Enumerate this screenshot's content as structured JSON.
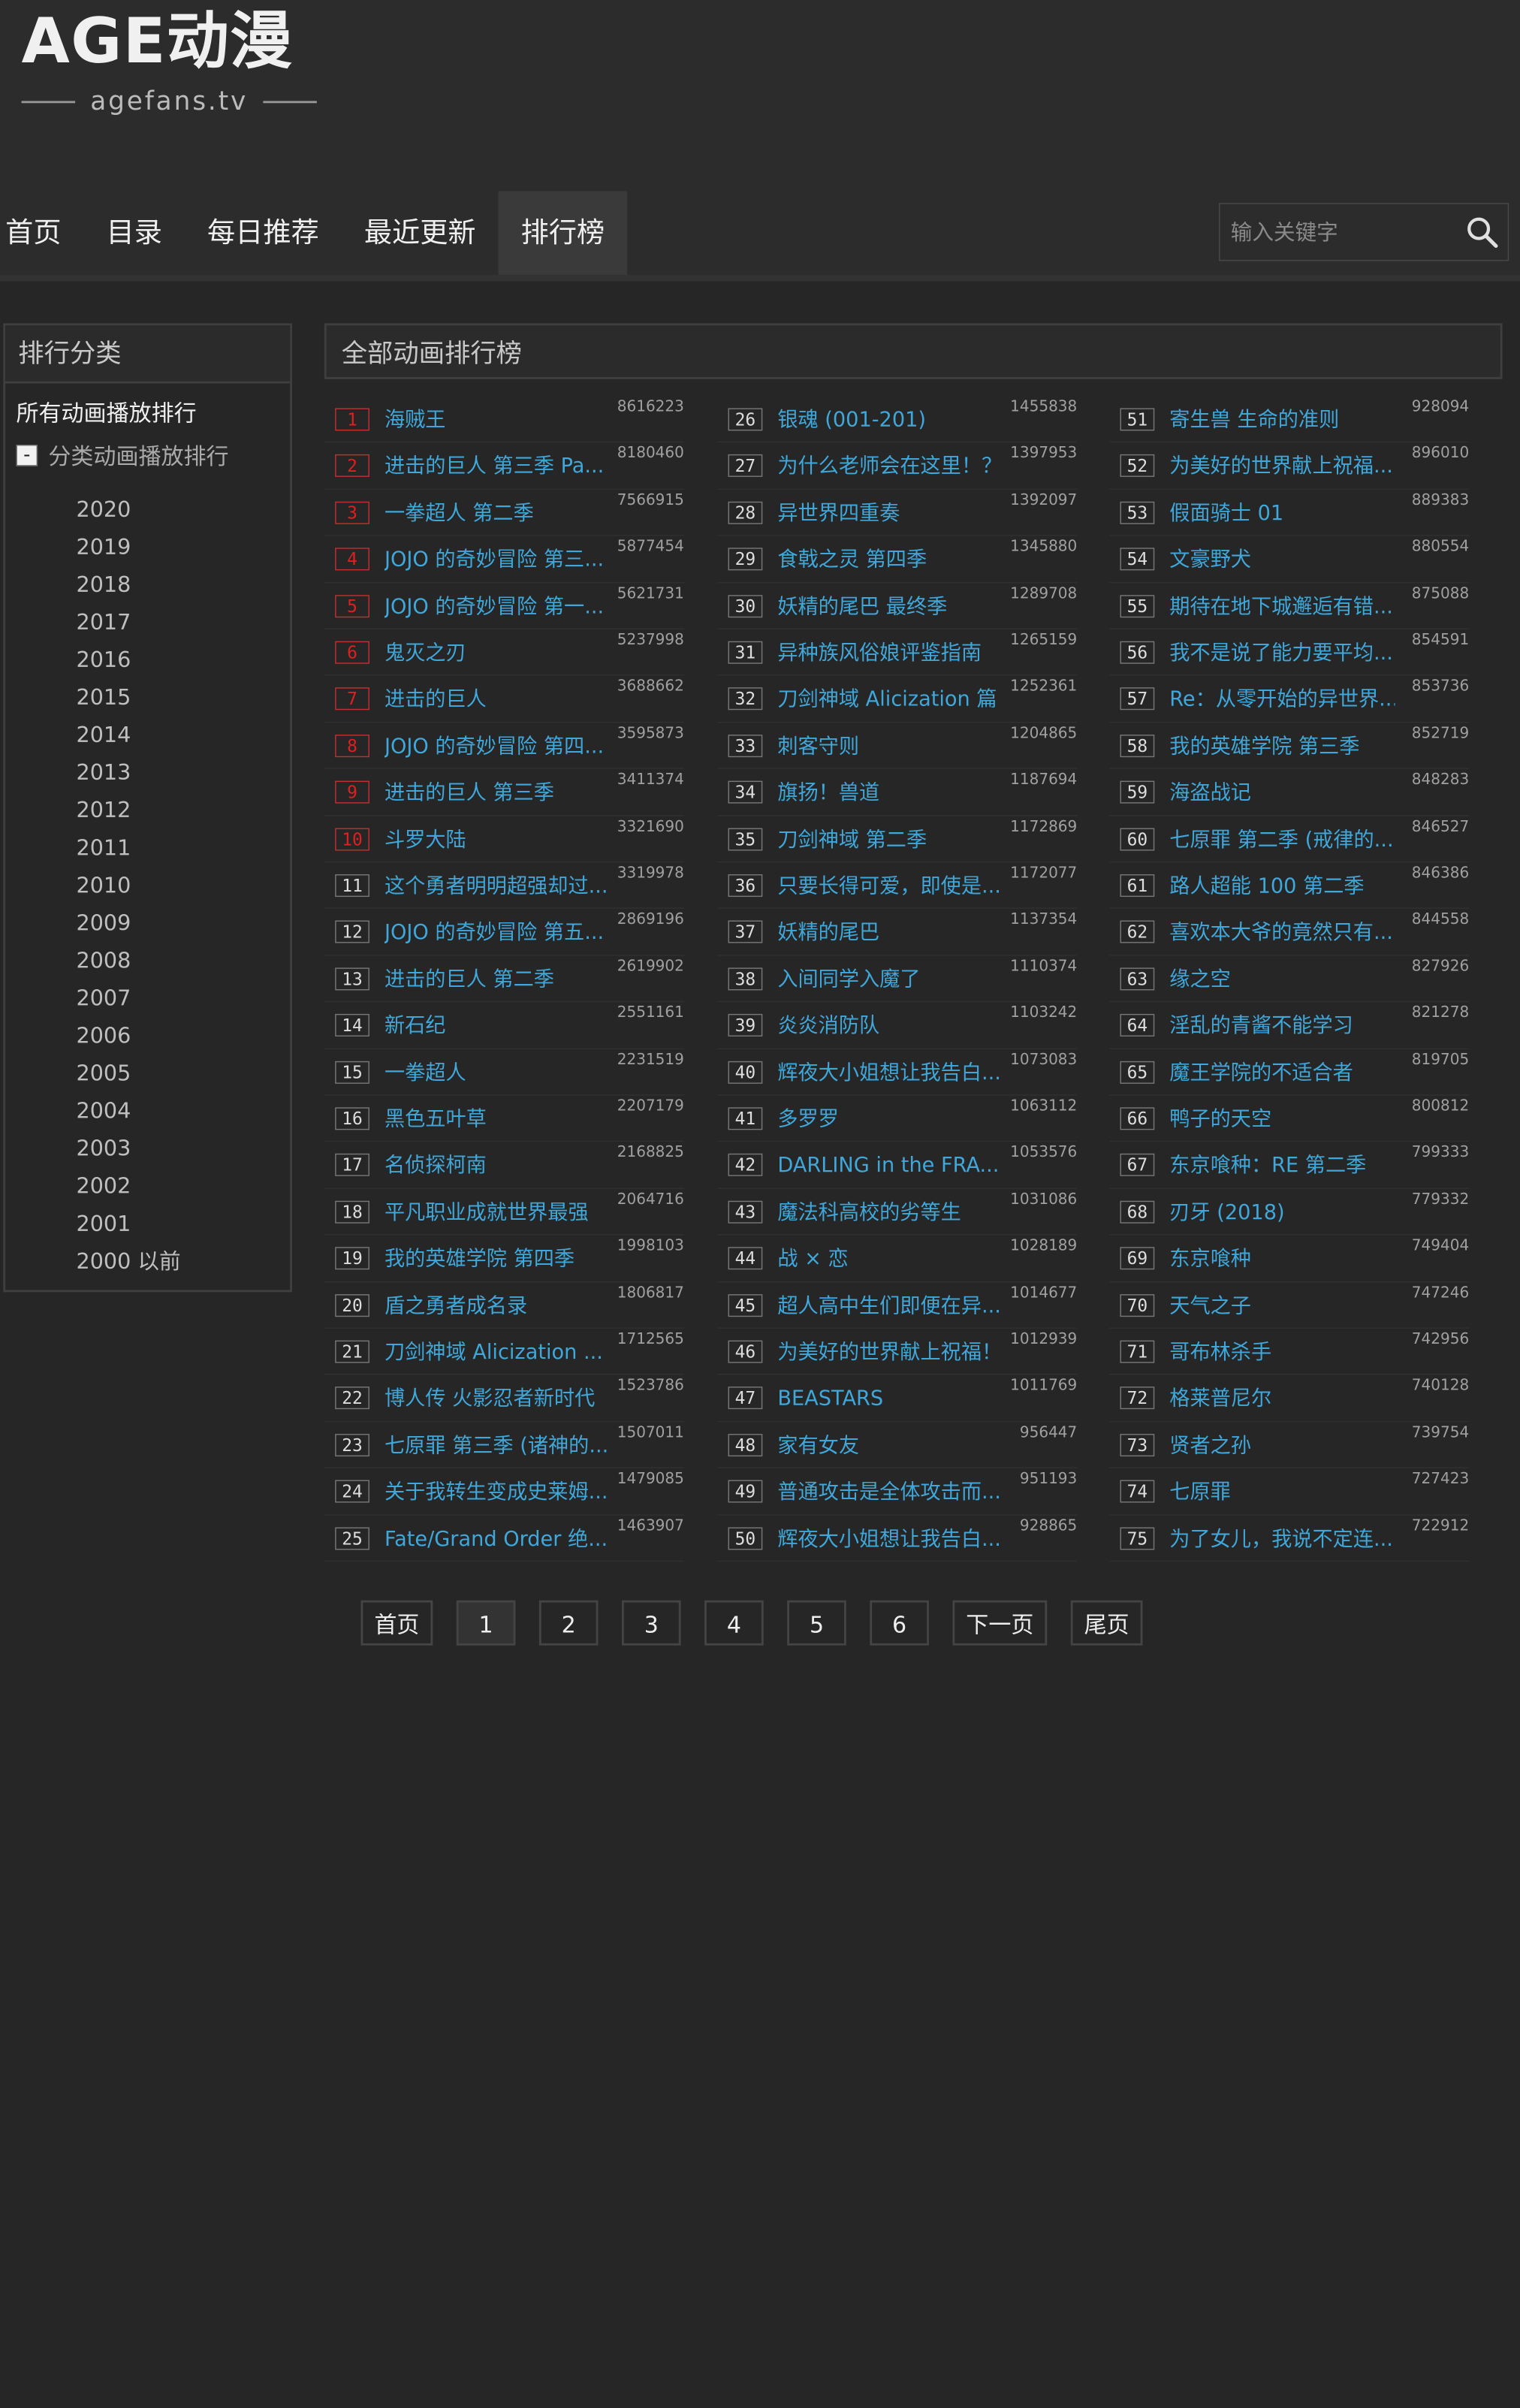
{
  "logo": {
    "main": "AGE动漫",
    "sub": "agefans.tv"
  },
  "nav": [
    "首页",
    "目录",
    "每日推荐",
    "最近更新",
    "排行榜"
  ],
  "search": {
    "placeholder": "输入关键字"
  },
  "sidebar": {
    "title": "排行分类",
    "all_label": "所有动画播放排行",
    "category_label": "分类动画播放排行",
    "toggle": "-",
    "years": [
      "2020",
      "2019",
      "2018",
      "2017",
      "2016",
      "2015",
      "2014",
      "2013",
      "2012",
      "2011",
      "2010",
      "2009",
      "2008",
      "2007",
      "2006",
      "2005",
      "2004",
      "2003",
      "2002",
      "2001",
      "2000 以前"
    ]
  },
  "main": {
    "title": "全部动画排行榜"
  },
  "ranking": [
    {
      "rank": "1",
      "title": "海贼王",
      "count": "8616223"
    },
    {
      "rank": "2",
      "title": "进击的巨人 第三季 Pa...",
      "count": "8180460"
    },
    {
      "rank": "3",
      "title": "一拳超人 第二季",
      "count": "7566915"
    },
    {
      "rank": "4",
      "title": "JOJO 的奇妙冒险 第三...",
      "count": "5877454"
    },
    {
      "rank": "5",
      "title": "JOJO 的奇妙冒险 第一...",
      "count": "5621731"
    },
    {
      "rank": "6",
      "title": "鬼灭之刃",
      "count": "5237998"
    },
    {
      "rank": "7",
      "title": "进击的巨人",
      "count": "3688662"
    },
    {
      "rank": "8",
      "title": "JOJO 的奇妙冒险 第四...",
      "count": "3595873"
    },
    {
      "rank": "9",
      "title": "进击的巨人 第三季",
      "count": "3411374"
    },
    {
      "rank": "10",
      "title": "斗罗大陆",
      "count": "3321690"
    },
    {
      "rank": "11",
      "title": "这个勇者明明超强却过...",
      "count": "3319978"
    },
    {
      "rank": "12",
      "title": "JOJO 的奇妙冒险 第五...",
      "count": "2869196"
    },
    {
      "rank": "13",
      "title": "进击的巨人 第二季",
      "count": "2619902"
    },
    {
      "rank": "14",
      "title": "新石纪",
      "count": "2551161"
    },
    {
      "rank": "15",
      "title": "一拳超人",
      "count": "2231519"
    },
    {
      "rank": "16",
      "title": "黑色五叶草",
      "count": "2207179"
    },
    {
      "rank": "17",
      "title": "名侦探柯南",
      "count": "2168825"
    },
    {
      "rank": "18",
      "title": "平凡职业成就世界最强",
      "count": "2064716"
    },
    {
      "rank": "19",
      "title": "我的英雄学院 第四季",
      "count": "1998103"
    },
    {
      "rank": "20",
      "title": "盾之勇者成名录",
      "count": "1806817"
    },
    {
      "rank": "21",
      "title": "刀剑神域 Alicization ...",
      "count": "1712565"
    },
    {
      "rank": "22",
      "title": "博人传 火影忍者新时代",
      "count": "1523786"
    },
    {
      "rank": "23",
      "title": "七原罪 第三季 (诸神的...",
      "count": "1507011"
    },
    {
      "rank": "24",
      "title": "关于我转生变成史莱姆...",
      "count": "1479085"
    },
    {
      "rank": "25",
      "title": "Fate/Grand Order 绝...",
      "count": "1463907"
    },
    {
      "rank": "26",
      "title": "银魂 (001-201)",
      "count": "1455838"
    },
    {
      "rank": "27",
      "title": "为什么老师会在这里！？",
      "count": "1397953"
    },
    {
      "rank": "28",
      "title": "异世界四重奏",
      "count": "1392097"
    },
    {
      "rank": "29",
      "title": "食戟之灵 第四季",
      "count": "1345880"
    },
    {
      "rank": "30",
      "title": "妖精的尾巴 最终季",
      "count": "1289708"
    },
    {
      "rank": "31",
      "title": "异种族风俗娘评鉴指南",
      "count": "1265159"
    },
    {
      "rank": "32",
      "title": "刀剑神域 Alicization 篇",
      "count": "1252361"
    },
    {
      "rank": "33",
      "title": "刺客守则",
      "count": "1204865"
    },
    {
      "rank": "34",
      "title": "旗扬！兽道",
      "count": "1187694"
    },
    {
      "rank": "35",
      "title": "刀剑神域 第二季",
      "count": "1172869"
    },
    {
      "rank": "36",
      "title": "只要长得可爱，即使是...",
      "count": "1172077"
    },
    {
      "rank": "37",
      "title": "妖精的尾巴",
      "count": "1137354"
    },
    {
      "rank": "38",
      "title": "入间同学入魔了",
      "count": "1110374"
    },
    {
      "rank": "39",
      "title": "炎炎消防队",
      "count": "1103242"
    },
    {
      "rank": "40",
      "title": "辉夜大小姐想让我告白...",
      "count": "1073083"
    },
    {
      "rank": "41",
      "title": "多罗罗",
      "count": "1063112"
    },
    {
      "rank": "42",
      "title": "DARLING in the FRA...",
      "count": "1053576"
    },
    {
      "rank": "43",
      "title": "魔法科高校的劣等生",
      "count": "1031086"
    },
    {
      "rank": "44",
      "title": "战 × 恋",
      "count": "1028189"
    },
    {
      "rank": "45",
      "title": "超人高中生们即便在异...",
      "count": "1014677"
    },
    {
      "rank": "46",
      "title": "为美好的世界献上祝福！",
      "count": "1012939"
    },
    {
      "rank": "47",
      "title": "BEASTARS",
      "count": "1011769"
    },
    {
      "rank": "48",
      "title": "家有女友",
      "count": "956447"
    },
    {
      "rank": "49",
      "title": "普通攻击是全体攻击而...",
      "count": "951193"
    },
    {
      "rank": "50",
      "title": "辉夜大小姐想让我告白...",
      "count": "928865"
    },
    {
      "rank": "51",
      "title": "寄生兽 生命的准则",
      "count": "928094"
    },
    {
      "rank": "52",
      "title": "为美好的世界献上祝福...",
      "count": "896010"
    },
    {
      "rank": "53",
      "title": "假面骑士 01",
      "count": "889383"
    },
    {
      "rank": "54",
      "title": "文豪野犬",
      "count": "880554"
    },
    {
      "rank": "55",
      "title": "期待在地下城邂逅有错...",
      "count": "875088"
    },
    {
      "rank": "56",
      "title": "我不是说了能力要平均...",
      "count": "854591"
    },
    {
      "rank": "57",
      "title": "Re：从零开始的异世界...",
      "count": "853736"
    },
    {
      "rank": "58",
      "title": "我的英雄学院 第三季",
      "count": "852719"
    },
    {
      "rank": "59",
      "title": "海盗战记",
      "count": "848283"
    },
    {
      "rank": "60",
      "title": "七原罪 第二季 (戒律的...",
      "count": "846527"
    },
    {
      "rank": "61",
      "title": "路人超能 100 第二季",
      "count": "846386"
    },
    {
      "rank": "62",
      "title": "喜欢本大爷的竟然只有...",
      "count": "844558"
    },
    {
      "rank": "63",
      "title": "缘之空",
      "count": "827926"
    },
    {
      "rank": "64",
      "title": "淫乱的青酱不能学习",
      "count": "821278"
    },
    {
      "rank": "65",
      "title": "魔王学院的不适合者",
      "count": "819705"
    },
    {
      "rank": "66",
      "title": "鸭子的天空",
      "count": "800812"
    },
    {
      "rank": "67",
      "title": "东京喰种：RE 第二季",
      "count": "799333"
    },
    {
      "rank": "68",
      "title": "刃牙 (2018)",
      "count": "779332"
    },
    {
      "rank": "69",
      "title": "东京喰种",
      "count": "749404"
    },
    {
      "rank": "70",
      "title": "天气之子",
      "count": "747246"
    },
    {
      "rank": "71",
      "title": "哥布林杀手",
      "count": "742956"
    },
    {
      "rank": "72",
      "title": "格莱普尼尔",
      "count": "740128"
    },
    {
      "rank": "73",
      "title": "贤者之孙",
      "count": "739754"
    },
    {
      "rank": "74",
      "title": "七原罪",
      "count": "727423"
    },
    {
      "rank": "75",
      "title": "为了女儿，我说不定连...",
      "count": "722912"
    }
  ],
  "pagination": {
    "first": "首页",
    "pages": [
      "1",
      "2",
      "3",
      "4",
      "5",
      "6"
    ],
    "current": "1",
    "next": "下一页",
    "last": "尾页"
  },
  "colors": {
    "background": "#262626",
    "link": "#3fa7da",
    "top_rank": "#e02020"
  }
}
